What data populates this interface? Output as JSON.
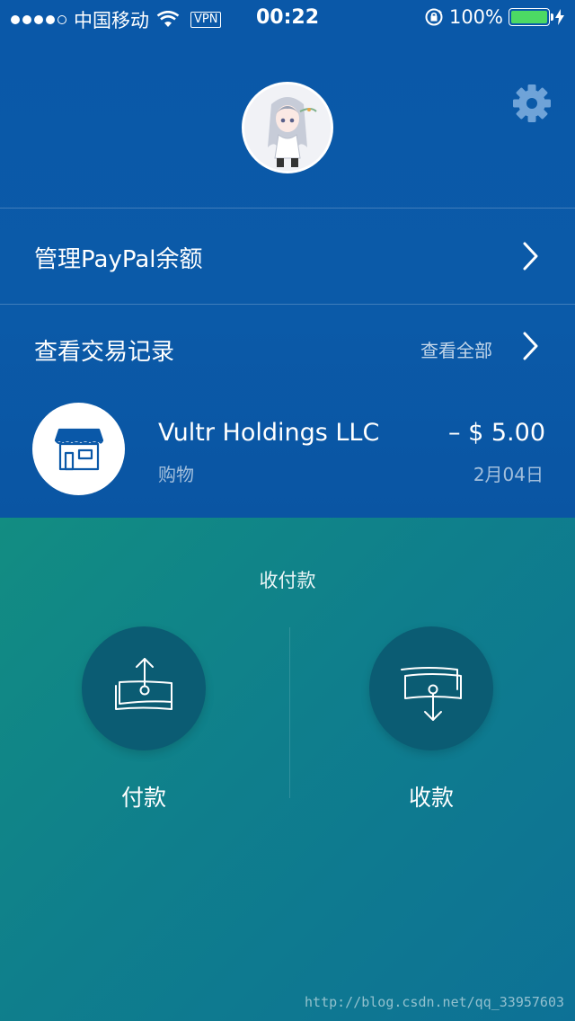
{
  "status_bar": {
    "carrier": "中国移动",
    "vpn": "VPN",
    "time": "00:22",
    "battery": "100%"
  },
  "header": {
    "avatar_icon": "user-avatar",
    "settings_icon": "gear-icon"
  },
  "menu": {
    "balance_label": "管理PayPal余额",
    "history_label": "查看交易记录",
    "see_all": "查看全部"
  },
  "transaction": {
    "merchant": "Vultr Holdings LLC",
    "category": "购物",
    "amount": "– $ 5.00",
    "date": "2月04日",
    "icon": "store-icon"
  },
  "payments": {
    "title": "收付款",
    "send_label": "付款",
    "receive_label": "收款"
  },
  "watermark": "http://blog.csdn.net/qq_33957603",
  "colors": {
    "top_bg": "#0a58a8",
    "bottom_bg": "#0f7f8c",
    "action_circle": "#0b5c73",
    "battery": "#4cd964"
  }
}
